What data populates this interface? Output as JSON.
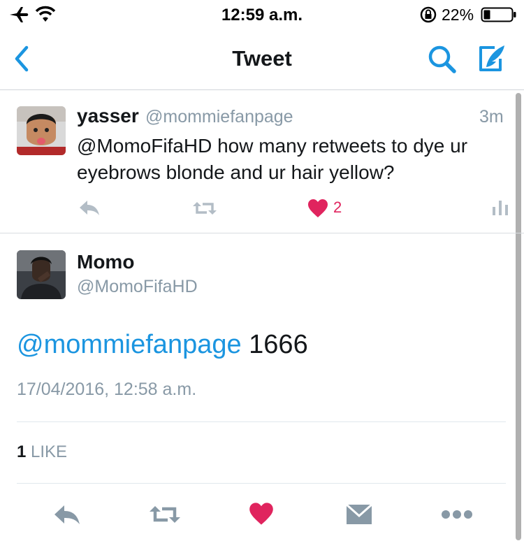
{
  "status_bar": {
    "time": "12:59 a.m.",
    "battery_percent": "22%"
  },
  "nav": {
    "title": "Tweet"
  },
  "parent_tweet": {
    "name": "yasser",
    "handle": "@mommiefanpage",
    "time": "3m",
    "text": "@MomoFifaHD how many retweets to dye ur eyebrows blonde and ur hair yellow?",
    "like_count": "2"
  },
  "main_tweet": {
    "name": "Momo",
    "handle": "@MomoFifaHD",
    "mention": "@mommiefanpage",
    "body": " 1666",
    "timestamp": "17/04/2016, 12:58 a.m.",
    "likes_count": "1",
    "likes_label": " LIKE"
  },
  "colors": {
    "accent": "#1b95e0",
    "like_red": "#e0245e",
    "muted": "#8899a6",
    "text": "#14171a"
  }
}
